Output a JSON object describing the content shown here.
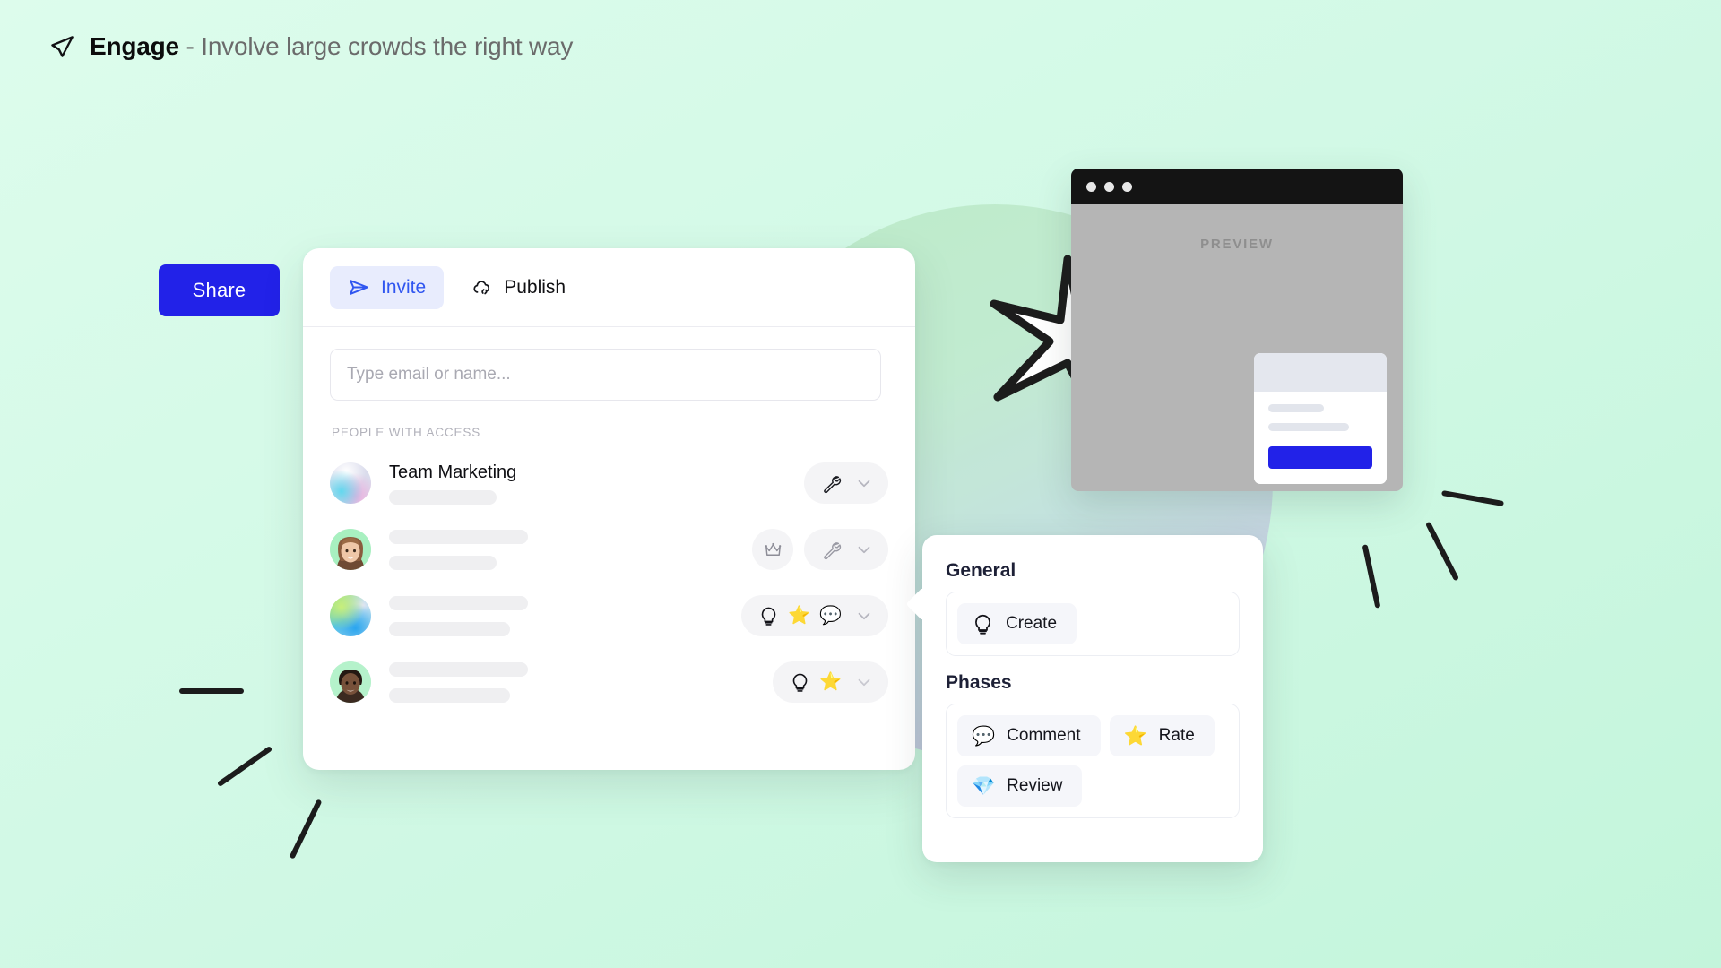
{
  "header": {
    "brand": "Engage",
    "tagline": "- Involve large crowds the right way",
    "icon": "megaphone-icon"
  },
  "share_button": {
    "label": "Share"
  },
  "share_dialog": {
    "tabs": [
      {
        "label": "Invite",
        "icon": "send-icon",
        "active": true
      },
      {
        "label": "Publish",
        "icon": "cloud-link-icon",
        "active": false
      }
    ],
    "email_input": {
      "value": "",
      "placeholder": "Type email or name..."
    },
    "people_section_label": "People with access",
    "people": [
      {
        "name": "Team Marketing",
        "avatar": "gradient-avatar",
        "has_crown": false,
        "chip_icons": [
          "wrench-icon"
        ]
      },
      {
        "name": "",
        "avatar": "photo-avatar-woman",
        "has_crown": true,
        "chip_icons": [
          "wrench-icon"
        ]
      },
      {
        "name": "",
        "avatar": "gradient-avatar",
        "has_crown": false,
        "chip_icons": [
          "lightbulb-icon",
          "star-icon",
          "speech-bubble-icon"
        ]
      },
      {
        "name": "",
        "avatar": "photo-avatar-man",
        "has_crown": false,
        "chip_icons": [
          "lightbulb-icon",
          "star-icon"
        ]
      }
    ]
  },
  "permissions_popover": {
    "general_heading": "General",
    "general_options": [
      {
        "label": "Create",
        "icon": "lightbulb-icon"
      }
    ],
    "phases_heading": "Phases",
    "phases_options": [
      {
        "label": "Comment",
        "icon": "speech-bubble-icon"
      },
      {
        "label": "Rate",
        "icon": "star-icon"
      },
      {
        "label": "Review",
        "icon": "gem-icon"
      }
    ]
  },
  "preview_window": {
    "label": "PREVIEW",
    "window_dots": 3
  },
  "colors": {
    "accent_blue": "#2222e8",
    "tab_active_blue": "#3056f0",
    "tab_active_bg": "#e8ecfd",
    "background_mint_start": "#ddfcec",
    "background_mint_end": "#c3f5db",
    "star_orange": "#f8a524",
    "speech_blue": "#a7cdf0",
    "gem_blue": "#6fc5f0",
    "chip_grey": "#f4f4f6"
  }
}
